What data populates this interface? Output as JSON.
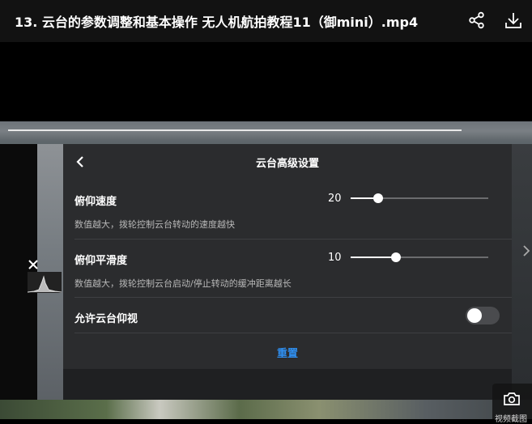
{
  "header": {
    "title": "13. 云台的参数调整和基本操作 无人机航拍教程11（御mini）.mp4",
    "icons": [
      "share-icon",
      "download-icon"
    ]
  },
  "panel": {
    "title": "云台高级设置",
    "rows": [
      {
        "label": "俯仰速度",
        "value": "20",
        "slider_fraction": 0.2,
        "desc": "数值越大，拨轮控制云台转动的速度越快"
      },
      {
        "label": "俯仰平滑度",
        "value": "10",
        "slider_fraction": 0.33,
        "desc": "数值越大，拨轮控制云台启动/停止转动的缓冲距离越长"
      }
    ],
    "toggle": {
      "label": "允许云台仰视",
      "on": false
    },
    "reset_label": "重置"
  },
  "overlay": {
    "screenshot_label": "视频截图"
  },
  "colors": {
    "accent": "#2f8ff0",
    "panel_bg": "#2b2c2e",
    "header_bg": "#121212"
  }
}
